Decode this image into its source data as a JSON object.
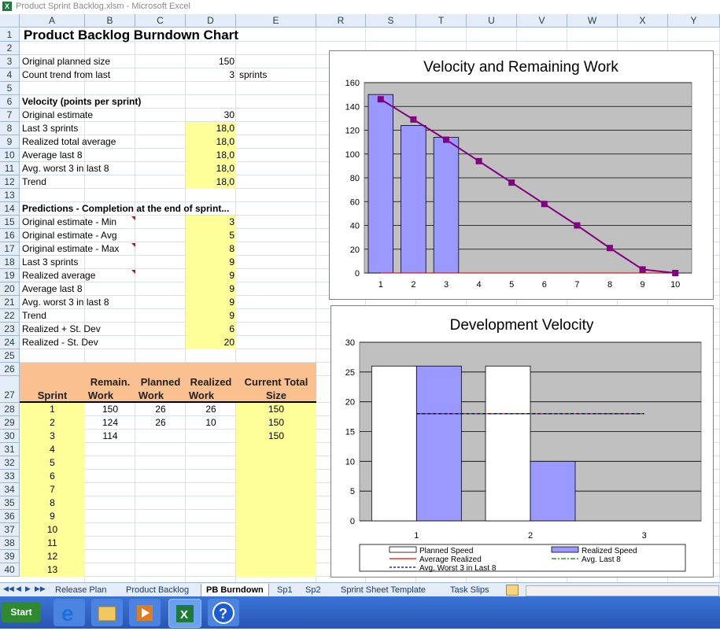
{
  "window": {
    "title": "Product Sprint Backlog.xlsm - Microsoft Excel"
  },
  "columns": [
    "A",
    "B",
    "C",
    "D",
    "E",
    "R",
    "S",
    "T",
    "U",
    "V",
    "W",
    "X",
    "Y"
  ],
  "rows": [
    "1",
    "2",
    "3",
    "4",
    "5",
    "6",
    "7",
    "8",
    "9",
    "10",
    "11",
    "12",
    "13",
    "14",
    "15",
    "16",
    "17",
    "18",
    "19",
    "20",
    "21",
    "22",
    "23",
    "24",
    "25",
    "26",
    "27",
    "28",
    "29",
    "30",
    "31",
    "32",
    "33",
    "34",
    "35",
    "36",
    "37",
    "38",
    "39",
    "40"
  ],
  "sheet": {
    "title": "Product Backlog Burndown Chart",
    "original_planned_size_label": "Original planned size",
    "original_planned_size": "150",
    "count_trend_label": "Count trend from last",
    "count_trend_value": "3",
    "count_trend_unit": "sprints",
    "velocity_header": "Velocity (points per sprint)",
    "velocity": [
      {
        "label": "Original estimate",
        "value": "30"
      },
      {
        "label": "Last 3 sprints",
        "value": "18,0"
      },
      {
        "label": "Realized total average",
        "value": "18,0"
      },
      {
        "label": "Average last 8",
        "value": "18,0"
      },
      {
        "label": "Avg. worst 3 in last 8",
        "value": "18,0"
      },
      {
        "label": "Trend",
        "value": "18,0"
      }
    ],
    "predictions_header": "Predictions - Completion at the end of sprint...",
    "predictions": [
      {
        "label": "Original estimate - Min",
        "value": "3"
      },
      {
        "label": "Original estimate - Avg",
        "value": "5"
      },
      {
        "label": "Original estimate - Max",
        "value": "8"
      },
      {
        "label": "Last 3 sprints",
        "value": "9"
      },
      {
        "label": "Realized average",
        "value": "9"
      },
      {
        "label": "Average last 8",
        "value": "9"
      },
      {
        "label": "Avg. worst 3 in last 8",
        "value": "9"
      },
      {
        "label": "Trend",
        "value": "9"
      },
      {
        "label": "Realized + St. Dev",
        "value": "6"
      },
      {
        "label": "Realized - St. Dev",
        "value": "20"
      }
    ],
    "table_headers": {
      "sprint": "Sprint",
      "remain1": "Remain.",
      "remain2": "Work",
      "planned1": "Planned",
      "planned2": "Work",
      "realized1": "Realized",
      "realized2": "Work",
      "total1": "Current Total",
      "total2": "Size"
    },
    "table_rows": [
      {
        "sprint": "1",
        "remain": "150",
        "planned": "26",
        "realized": "26",
        "total": "150"
      },
      {
        "sprint": "2",
        "remain": "124",
        "planned": "26",
        "realized": "10",
        "total": "150"
      },
      {
        "sprint": "3",
        "remain": "114",
        "planned": "",
        "realized": "",
        "total": "150"
      },
      {
        "sprint": "4",
        "remain": "",
        "planned": "",
        "realized": "",
        "total": ""
      },
      {
        "sprint": "5",
        "remain": "",
        "planned": "",
        "realized": "",
        "total": ""
      },
      {
        "sprint": "6",
        "remain": "",
        "planned": "",
        "realized": "",
        "total": ""
      },
      {
        "sprint": "7",
        "remain": "",
        "planned": "",
        "realized": "",
        "total": ""
      },
      {
        "sprint": "8",
        "remain": "",
        "planned": "",
        "realized": "",
        "total": ""
      },
      {
        "sprint": "9",
        "remain": "",
        "planned": "",
        "realized": "",
        "total": ""
      },
      {
        "sprint": "10",
        "remain": "",
        "planned": "",
        "realized": "",
        "total": ""
      },
      {
        "sprint": "11",
        "remain": "",
        "planned": "",
        "realized": "",
        "total": ""
      },
      {
        "sprint": "12",
        "remain": "",
        "planned": "",
        "realized": "",
        "total": ""
      },
      {
        "sprint": "13",
        "remain": "",
        "planned": "",
        "realized": "",
        "total": ""
      }
    ]
  },
  "tabs": [
    "Release Plan",
    "Product Backlog",
    "PB Burndown",
    "Sp1",
    "Sp2",
    "Sprint Sheet Template",
    "Task Slips"
  ],
  "active_tab": "PB Burndown",
  "taskbar": {
    "start_label": "Start",
    "icons": [
      "internet-explorer-icon",
      "file-explorer-icon",
      "media-player-icon",
      "excel-icon",
      "help-icon"
    ]
  },
  "colors": {
    "bar_fill": "#9999ff",
    "line_purple": "#800080",
    "plot_bg": "#c0c0c0",
    "yellow_cell": "#ffff99",
    "orange_header": "#fac090",
    "avg_realized": "#ff0000",
    "avg_last8": "#008000",
    "avg_worst3": "#000080"
  },
  "chart_data": [
    {
      "type": "bar",
      "title": "Velocity and Remaining Work",
      "categories": [
        "1",
        "2",
        "3",
        "4",
        "5",
        "6",
        "7",
        "8",
        "9",
        "10"
      ],
      "ylim": [
        0,
        160
      ],
      "yticks": [
        0,
        20,
        40,
        60,
        80,
        100,
        120,
        140,
        160
      ],
      "grid": true,
      "series": [
        {
          "kind": "bar",
          "values": [
            150,
            124,
            114,
            null,
            null,
            null,
            null,
            null,
            null,
            null
          ]
        },
        {
          "kind": "line",
          "values": [
            146,
            129,
            112,
            94,
            76,
            58,
            40,
            21,
            3,
            0
          ]
        },
        {
          "kind": "line",
          "values": [
            0,
            0,
            0,
            0,
            0,
            0,
            0,
            0,
            0,
            0
          ]
        }
      ]
    },
    {
      "type": "bar",
      "title": "Development Velocity",
      "categories": [
        "1",
        "2",
        "3"
      ],
      "ylim": [
        0,
        30
      ],
      "yticks": [
        0,
        5,
        10,
        15,
        20,
        25,
        30
      ],
      "grid": true,
      "legend": "bottom",
      "series": [
        {
          "name": "Planned Speed",
          "kind": "bar",
          "values": [
            26,
            26,
            null
          ]
        },
        {
          "name": "Realized Speed",
          "kind": "bar",
          "values": [
            26,
            10,
            null
          ]
        },
        {
          "name": "Average Realized",
          "kind": "line",
          "values": [
            18,
            18,
            18
          ]
        },
        {
          "name": "Avg. Last 8",
          "kind": "line",
          "values": [
            18,
            18,
            18
          ]
        },
        {
          "name": "Avg. Worst 3 in Last 8",
          "kind": "line",
          "values": [
            18,
            18,
            18
          ]
        }
      ]
    }
  ]
}
